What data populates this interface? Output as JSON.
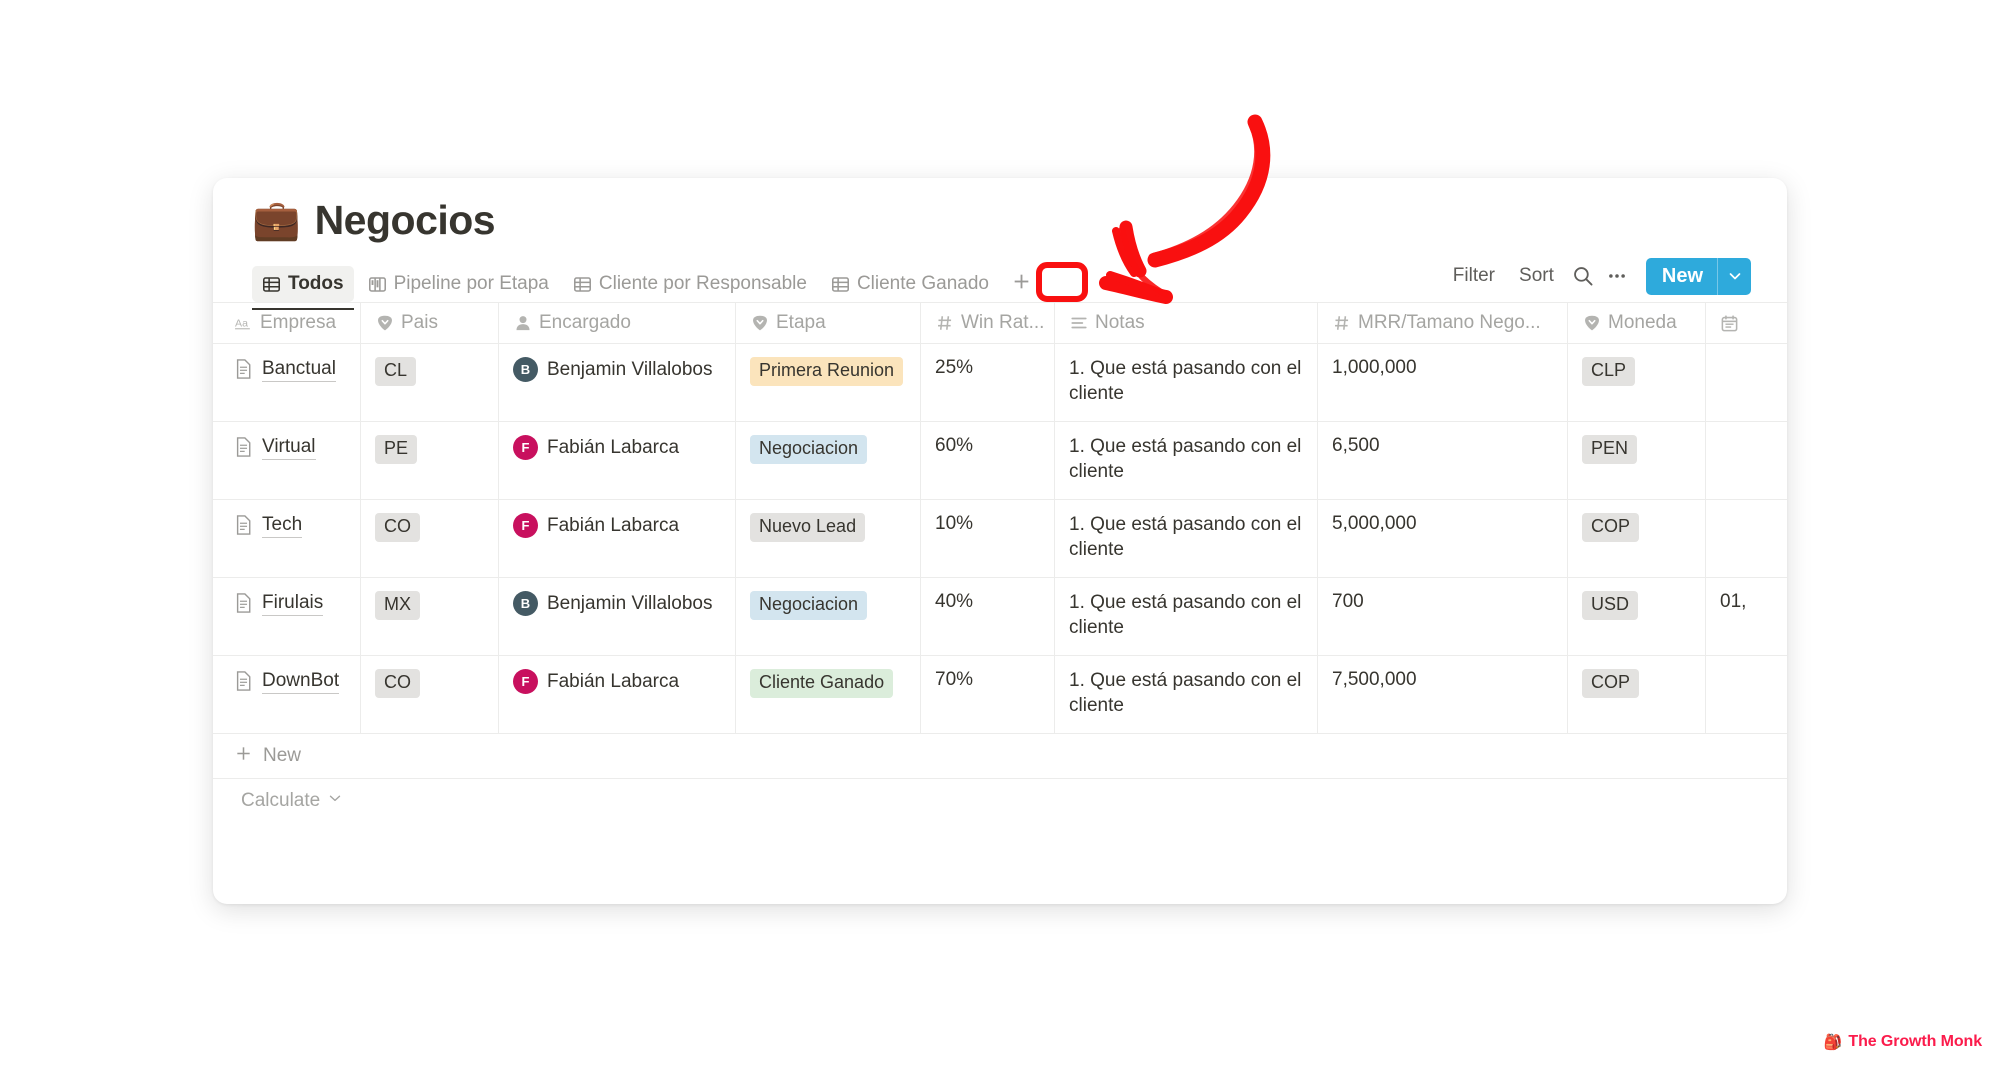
{
  "page": {
    "title": "Negocios",
    "emoji": "💼"
  },
  "tabs": [
    {
      "label": "Todos",
      "icon": "table-icon",
      "active": true
    },
    {
      "label": "Pipeline por Etapa",
      "icon": "board-icon",
      "active": false
    },
    {
      "label": "Cliente por Responsable",
      "icon": "table-icon",
      "active": false
    },
    {
      "label": "Cliente Ganado",
      "icon": "table-icon",
      "active": false
    }
  ],
  "add_view": {
    "label": "+",
    "icon": "plus-icon"
  },
  "toolbar": {
    "filter_label": "Filter",
    "sort_label": "Sort",
    "search_icon": "search-icon",
    "more_icon": "ellipsis-icon",
    "new_label": "New",
    "new_caret_icon": "chevron-down-icon"
  },
  "table": {
    "columns": [
      {
        "label": "Empresa",
        "icon": "title-aa-icon"
      },
      {
        "label": "Pais",
        "icon": "select-icon"
      },
      {
        "label": "Encargado",
        "icon": "person-icon"
      },
      {
        "label": "Etapa",
        "icon": "select-icon"
      },
      {
        "label": "Win Rat...",
        "icon": "number-hash-icon"
      },
      {
        "label": "Notas",
        "icon": "text-lines-icon"
      },
      {
        "label": "MRR/Tamano Nego...",
        "icon": "number-hash-icon"
      },
      {
        "label": "Moneda",
        "icon": "select-icon"
      },
      {
        "label": "",
        "icon": "calendar-icon"
      }
    ],
    "rows": [
      {
        "empresa": "Banctual",
        "pais": "CL",
        "encargado": {
          "initial": "B",
          "name": "Benjamin Villalobos",
          "color": "#445a64"
        },
        "etapa": {
          "label": "Primera Reunion",
          "color": "#fbe4bc"
        },
        "win_rate": "25%",
        "notas": "1. Que está pasando con el cliente",
        "mrr": "1,000,000",
        "moneda": "CLP",
        "fecha": ""
      },
      {
        "empresa": "Virtual",
        "pais": "PE",
        "encargado": {
          "initial": "F",
          "name": "Fabián Labarca",
          "color": "#c8105e"
        },
        "etapa": {
          "label": "Negociacion",
          "color": "#d3e5ef"
        },
        "win_rate": "60%",
        "notas": "1. Que está pasando con el cliente",
        "mrr": "6,500",
        "moneda": "PEN",
        "fecha": ""
      },
      {
        "empresa": "Tech",
        "pais": "CO",
        "encargado": {
          "initial": "F",
          "name": "Fabián Labarca",
          "color": "#c8105e"
        },
        "etapa": {
          "label": "Nuevo Lead",
          "color": "#e3e2e0"
        },
        "win_rate": "10%",
        "notas": "1. Que está pasando con el cliente",
        "mrr": "5,000,000",
        "moneda": "COP",
        "fecha": ""
      },
      {
        "empresa": "Firulais",
        "pais": "MX",
        "encargado": {
          "initial": "B",
          "name": "Benjamin Villalobos",
          "color": "#445a64"
        },
        "etapa": {
          "label": "Negociacion",
          "color": "#d3e5ef"
        },
        "win_rate": "40%",
        "notas": "1. Que está pasando con el cliente",
        "mrr": "700",
        "moneda": "USD",
        "fecha": "01,"
      },
      {
        "empresa": "DownBot",
        "pais": "CO",
        "encargado": {
          "initial": "F",
          "name": "Fabián Labarca",
          "color": "#c8105e"
        },
        "etapa": {
          "label": "Cliente Ganado",
          "color": "#dbeddb"
        },
        "win_rate": "70%",
        "notas": "1. Que está pasando con el cliente",
        "mrr": "7,500,000",
        "moneda": "COP",
        "fecha": ""
      }
    ],
    "new_row_label": "New",
    "calculate_label": "Calculate"
  },
  "annotation": {
    "color": "#f91010",
    "shape": "curved-arrow-pointing-to-add-view-button"
  },
  "watermark": {
    "text": "The Growth Monk",
    "icon": "🎒",
    "color": "#fb1b4b"
  }
}
